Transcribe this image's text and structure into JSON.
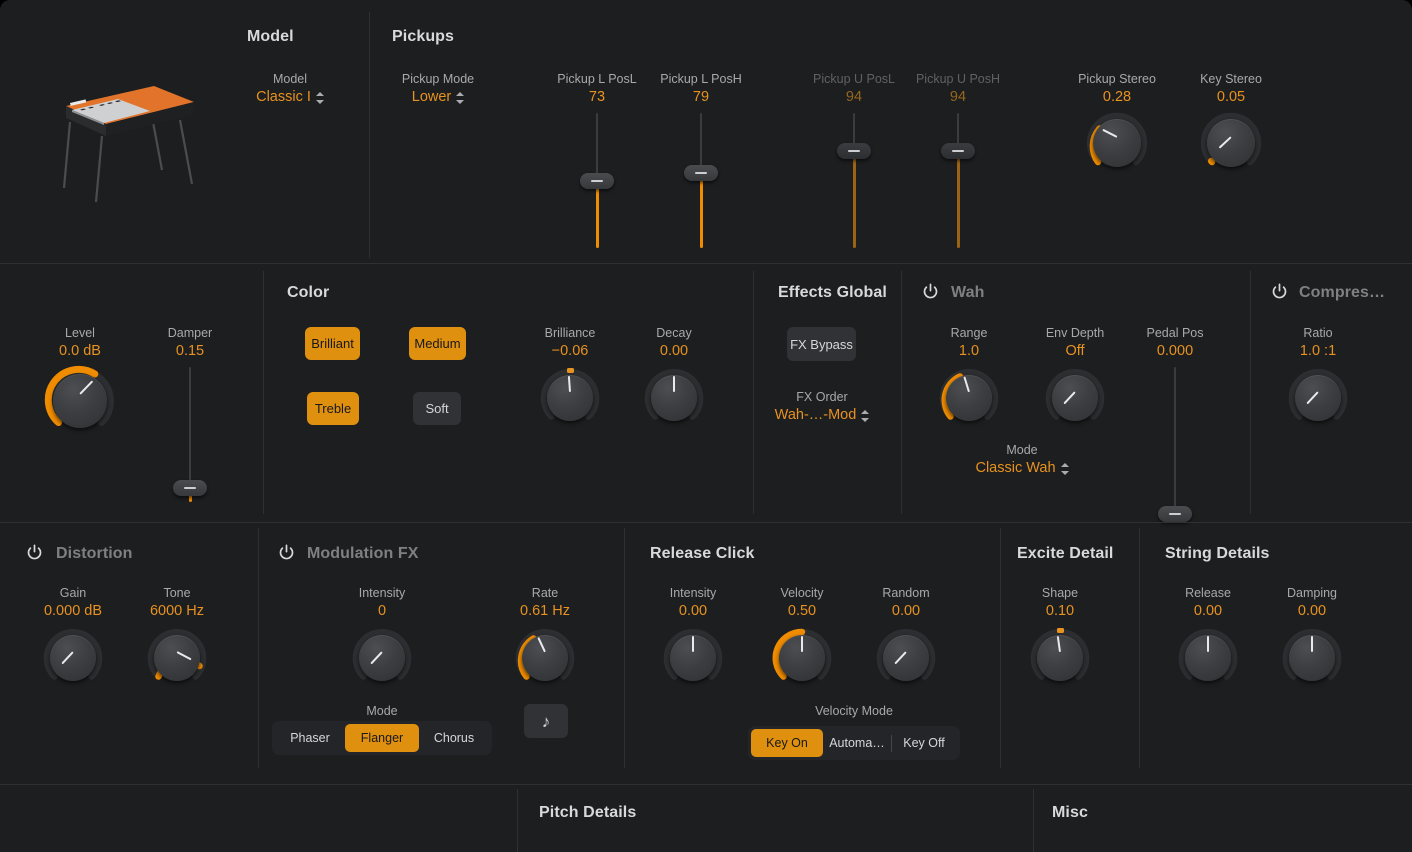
{
  "accent": "#e8921f",
  "accent_button": "#e0900f",
  "panel_bg": "#1d1e20",
  "knob_ring": "#2c2e31",
  "sections": {
    "model": {
      "title": "Model"
    },
    "pickups": {
      "title": "Pickups"
    },
    "color": {
      "title": "Color"
    },
    "effects_global": {
      "title": "Effects Global"
    },
    "wah": {
      "title": "Wah",
      "power_icon": "power-icon"
    },
    "compressor": {
      "title": "Compres…",
      "power_icon": "power-icon"
    },
    "distortion": {
      "title": "Distortion",
      "power_icon": "power-icon"
    },
    "modulation_fx": {
      "title": "Modulation FX",
      "power_icon": "power-icon"
    },
    "release_click": {
      "title": "Release Click"
    },
    "excite_detail": {
      "title": "Excite Detail"
    },
    "string_details": {
      "title": "String Details"
    },
    "pitch_details": {
      "title": "Pitch Details"
    },
    "misc": {
      "title": "Misc"
    }
  },
  "model": {
    "label": "Model",
    "value": "Classic I",
    "instrument_icon": "electric-piano-icon"
  },
  "pickups": {
    "mode_label": "Pickup Mode",
    "mode_value": "Lower",
    "l_posl": {
      "label": "Pickup L PosL",
      "value": "73"
    },
    "l_posh": {
      "label": "Pickup L PosH",
      "value": "79"
    },
    "u_posl": {
      "label": "Pickup U PosL",
      "value": "94"
    },
    "u_posh": {
      "label": "Pickup U PosH",
      "value": "94"
    },
    "stereo": {
      "label": "Pickup Stereo",
      "value": "0.28"
    },
    "key_stereo": {
      "label": "Key Stereo",
      "value": "0.05"
    }
  },
  "main": {
    "level": {
      "label": "Level",
      "value": "0.0 dB"
    },
    "damper": {
      "label": "Damper",
      "value": "0.15"
    },
    "brilliance": {
      "label": "Brilliance",
      "value": "−0.06"
    },
    "decay": {
      "label": "Decay",
      "value": "0.00"
    }
  },
  "color": {
    "buttons": [
      {
        "label": "Brilliant",
        "on": true
      },
      {
        "label": "Medium",
        "on": true
      },
      {
        "label": "Treble",
        "on": true
      },
      {
        "label": "Soft",
        "on": false
      }
    ]
  },
  "effects_global": {
    "fx_bypass_label": "FX Bypass",
    "fx_order_label": "FX Order",
    "fx_order_value": "Wah-…-Mod"
  },
  "wah": {
    "range": {
      "label": "Range",
      "value": "1.0"
    },
    "env_depth": {
      "label": "Env Depth",
      "value": "Off"
    },
    "pedal_pos": {
      "label": "Pedal Pos",
      "value": "0.000"
    },
    "mode_label": "Mode",
    "mode_value": "Classic Wah"
  },
  "compressor": {
    "ratio": {
      "label": "Ratio",
      "value": "1.0 :1"
    }
  },
  "distortion": {
    "gain": {
      "label": "Gain",
      "value": "0.000 dB"
    },
    "tone": {
      "label": "Tone",
      "value": "6000 Hz"
    }
  },
  "modulation_fx": {
    "intensity": {
      "label": "Intensity",
      "value": "0"
    },
    "rate": {
      "label": "Rate",
      "value": "0.61 Hz"
    },
    "sync_icon": "note-icon",
    "mode_label": "Mode",
    "modes": [
      {
        "label": "Phaser",
        "on": false
      },
      {
        "label": "Flanger",
        "on": true
      },
      {
        "label": "Chorus",
        "on": false
      }
    ]
  },
  "release_click": {
    "intensity": {
      "label": "Intensity",
      "value": "0.00"
    },
    "velocity": {
      "label": "Velocity",
      "value": "0.50"
    },
    "random": {
      "label": "Random",
      "value": "0.00"
    },
    "velocity_mode_label": "Velocity Mode",
    "velocity_modes": [
      {
        "label": "Key On",
        "on": true
      },
      {
        "label": "Automa…",
        "on": false
      },
      {
        "label": "Key Off",
        "on": false
      }
    ]
  },
  "excite_detail": {
    "shape": {
      "label": "Shape",
      "value": "0.10"
    }
  },
  "string_details": {
    "release": {
      "label": "Release",
      "value": "0.00"
    },
    "damping": {
      "label": "Damping",
      "value": "0.00"
    }
  }
}
